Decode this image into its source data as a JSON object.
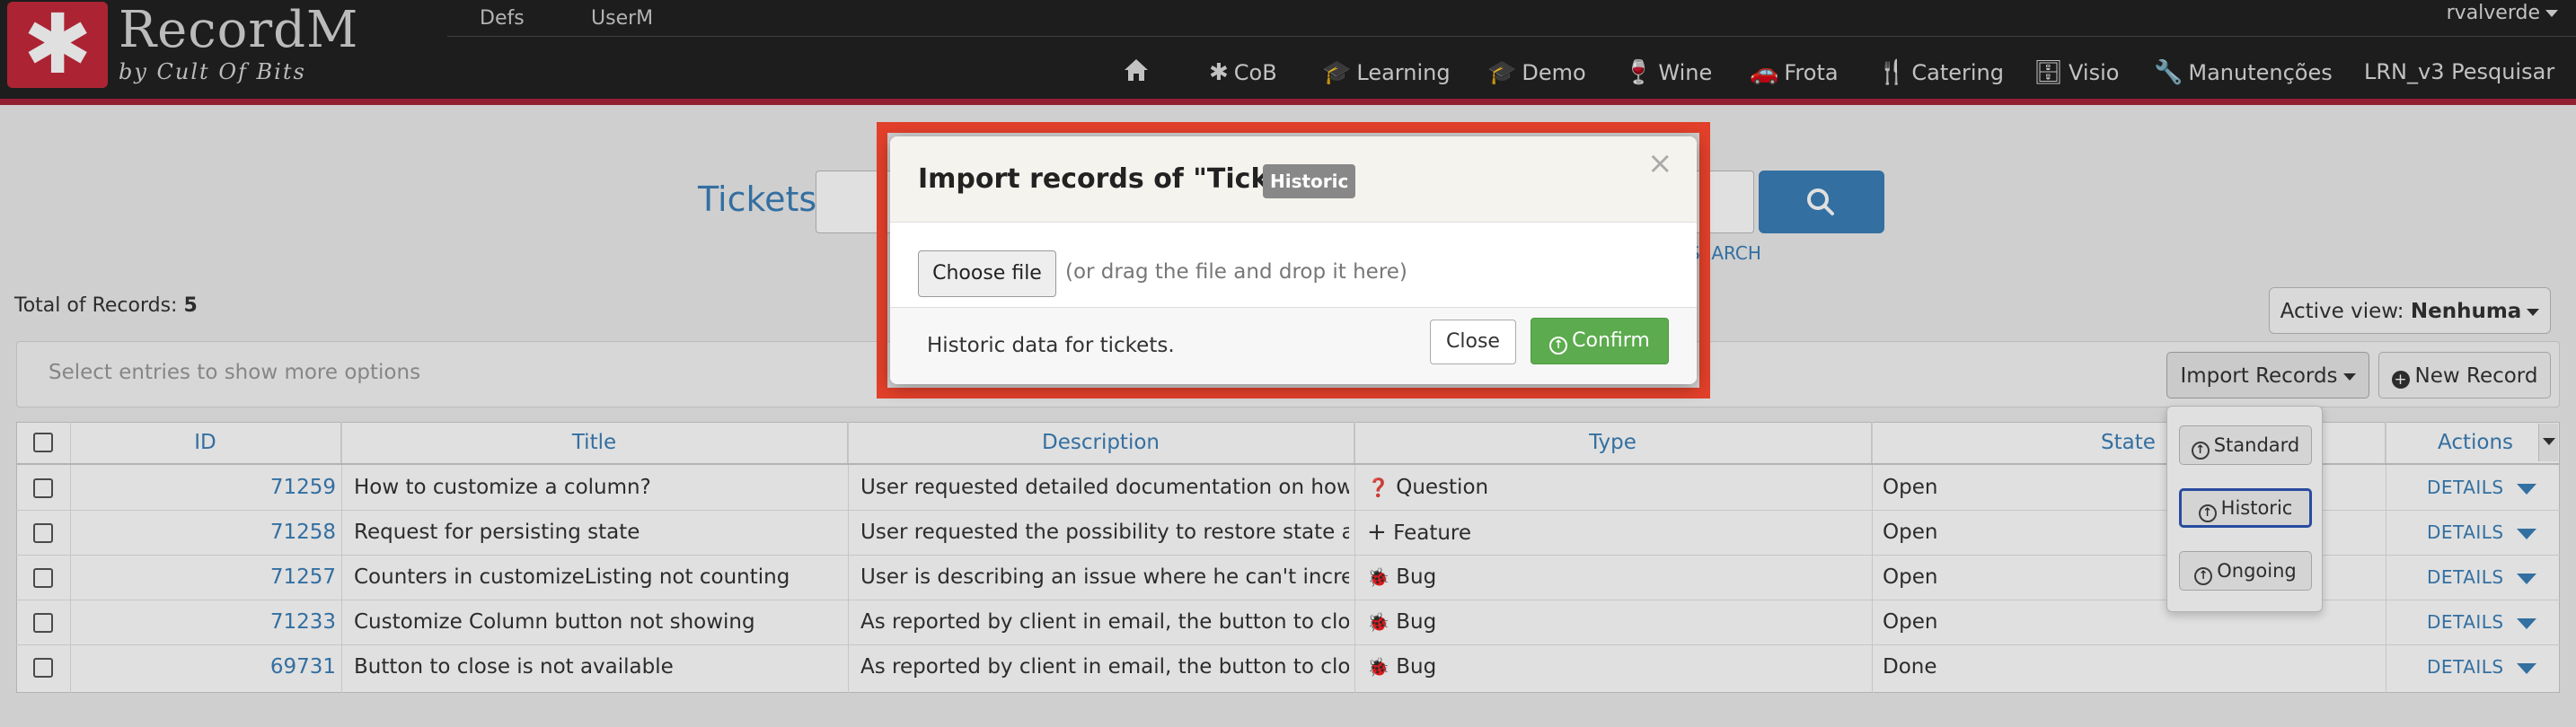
{
  "brand": {
    "name": "RecordM",
    "tagline": "by Cult Of Bits",
    "logo_glyph": "✱"
  },
  "topnav": {
    "links": [
      "Defs",
      "UserM"
    ],
    "user": "rvalverde"
  },
  "mainnav": [
    {
      "label": "CoB",
      "icon": "asterisk-icon",
      "glyph": "✱"
    },
    {
      "label": "Learning",
      "icon": "graduation-cap-icon",
      "glyph": "🎓"
    },
    {
      "label": "Demo",
      "icon": "graduation-cap-icon",
      "glyph": "🎓"
    },
    {
      "label": "Wine",
      "icon": "wine-glass-icon",
      "glyph": "🍷"
    },
    {
      "label": "Frota",
      "icon": "car-icon",
      "glyph": "🚗"
    },
    {
      "label": "Catering",
      "icon": "cutlery-icon",
      "glyph": "🍴"
    },
    {
      "label": "Visio",
      "icon": "database-icon",
      "glyph": "🗄"
    },
    {
      "label": "Manutenções",
      "icon": "wrench-icon",
      "glyph": "🔧"
    },
    {
      "label": "LRN_v3 Pesquisar",
      "icon": "",
      "glyph": ""
    }
  ],
  "search": {
    "label": "Tickets",
    "advanced_link": "SEARCH"
  },
  "summary": {
    "total_label": "Total of Records:",
    "total_value": "5"
  },
  "active_view": {
    "label": "Active view:",
    "value": "Nenhuma"
  },
  "toolbar": {
    "hint": "Select entries to show more options",
    "import_label": "Import Records",
    "new_label": "New Record"
  },
  "import_menu": [
    "Standard",
    "Historic",
    "Ongoing"
  ],
  "table": {
    "columns": [
      "ID",
      "Title",
      "Description",
      "Type",
      "State",
      "Actions"
    ],
    "rows": [
      {
        "id": "71259",
        "title": "How to customize a column?",
        "description": "User requested detailed documentation on how to",
        "type": "Question",
        "type_glyph": "❓",
        "state": "Open",
        "action": "DETAILS"
      },
      {
        "id": "71258",
        "title": "Request for persisting state",
        "description": "User requested the possibility to restore state afte",
        "type": "Feature",
        "type_glyph": "+",
        "state": "Open",
        "action": "DETAILS"
      },
      {
        "id": "71257",
        "title": "Counters in customizeListing not counting",
        "description": "User is describing an issue where he can't increase",
        "type": "Bug",
        "type_glyph": "🐞",
        "state": "Open",
        "action": "DETAILS"
      },
      {
        "id": "71233",
        "title": "Customize Column button not showing",
        "description": "As reported by client in email, the button to close",
        "type": "Bug",
        "type_glyph": "🐞",
        "state": "Open",
        "action": "DETAILS"
      },
      {
        "id": "69731",
        "title": "Button to close is not available",
        "description": "As reported by client in email, the button to close",
        "type": "Bug",
        "type_glyph": "🐞",
        "state": "Done",
        "action": "DETAILS"
      }
    ]
  },
  "modal": {
    "title": "Import records of \"Tickets\"",
    "badge": "Historic",
    "close_glyph": "×",
    "choose_file": "Choose file",
    "drag_hint": "(or drag the file and drop it here)",
    "footer_text": "Historic data for tickets.",
    "close_label": "Close",
    "confirm_label": "Confirm"
  },
  "colors": {
    "accent": "#3b7fb8",
    "brand_red": "#c4293c",
    "confirm_green": "#5cab4e",
    "highlight": "#e2402a"
  }
}
